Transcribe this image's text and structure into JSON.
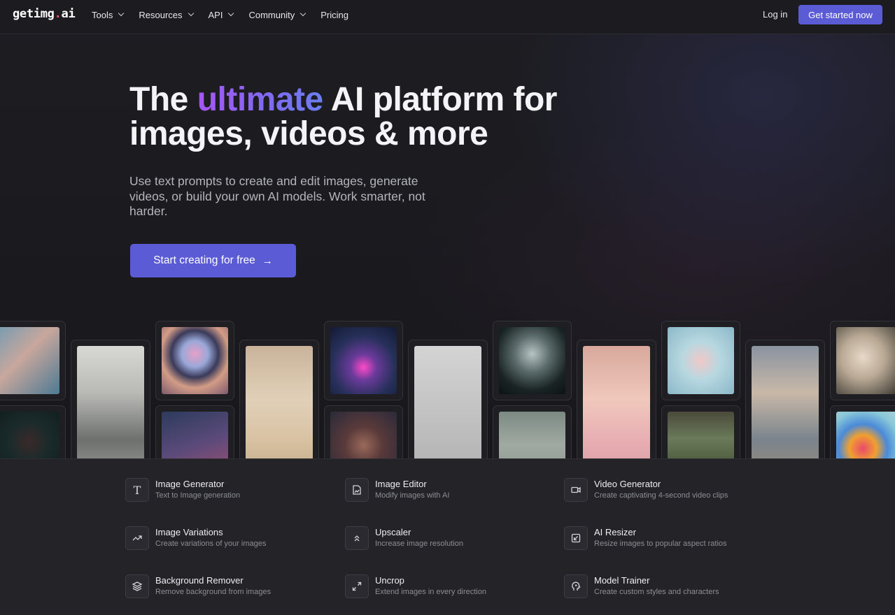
{
  "nav": {
    "logo_main": "getimg",
    "logo_dot": ".",
    "logo_tail": "ai",
    "items": [
      {
        "label": "Tools",
        "dropdown": true
      },
      {
        "label": "Resources",
        "dropdown": true
      },
      {
        "label": "API",
        "dropdown": true
      },
      {
        "label": "Community",
        "dropdown": true
      },
      {
        "label": "Pricing",
        "dropdown": false
      }
    ],
    "login_label": "Log in",
    "cta_label": "Get started now"
  },
  "hero": {
    "title_pre": "The",
    "title_accent": "ultimate",
    "title_post": "AI platform for",
    "title_line2": "images, videos & more",
    "subtitle": "Use text prompts to create and edit images, generate videos, or build your own AI models. Work smarter, not harder.",
    "cta_label": "Start creating for free",
    "cta_icon": "arrow-right-icon"
  },
  "gallery": {
    "cards": [
      {
        "name": "gallery-image-woman-face-profile"
      },
      {
        "name": "gallery-image-dark-portrait-red-light"
      },
      {
        "name": "gallery-image-vogue-statue"
      },
      {
        "name": "gallery-image-chrome-sphere"
      },
      {
        "name": "gallery-image-neon-creature"
      },
      {
        "name": "gallery-image-minimal-bedroom"
      },
      {
        "name": "gallery-image-neon-robot"
      },
      {
        "name": "gallery-image-glitter-face"
      },
      {
        "name": "gallery-image-wire-sculpture-head"
      },
      {
        "name": "gallery-image-alien-portrait"
      },
      {
        "name": "gallery-image-misty-figure"
      },
      {
        "name": "gallery-image-pink-bedroom-bears"
      },
      {
        "name": "gallery-image-glass-runner"
      },
      {
        "name": "gallery-image-greenhouse-interior"
      },
      {
        "name": "gallery-image-astronaut-doorway"
      },
      {
        "name": "gallery-image-porcelain-woman"
      },
      {
        "name": "gallery-image-balloon-cluster"
      }
    ]
  },
  "tools": [
    {
      "name": "Image Generator",
      "desc": "Text to Image generation",
      "icon": "text-t-icon"
    },
    {
      "name": "Image Editor",
      "desc": "Modify images with AI",
      "icon": "image-edit-icon"
    },
    {
      "name": "Video Generator",
      "desc": "Create captivating 4-second video clips",
      "icon": "video-camera-icon"
    },
    {
      "name": "Image Variations",
      "desc": "Create variations of your images",
      "icon": "trend-arrows-icon"
    },
    {
      "name": "Upscaler",
      "desc": "Increase image resolution",
      "icon": "double-chevron-up-icon"
    },
    {
      "name": "AI Resizer",
      "desc": "Resize images to popular aspect ratios",
      "icon": "resize-arrow-icon"
    },
    {
      "name": "Background Remover",
      "desc": "Remove background from images",
      "icon": "layers-icon"
    },
    {
      "name": "Uncrop",
      "desc": "Extend images in every direction",
      "icon": "expand-arrows-icon"
    },
    {
      "name": "Model Trainer",
      "desc": "Create custom styles and characters",
      "icon": "head-brain-icon"
    }
  ],
  "colors": {
    "accent": "#5b5bd6",
    "gradient_start": "#a855f7",
    "gradient_end": "#6b7ff0",
    "logo_dot": "#ff4d6a"
  }
}
